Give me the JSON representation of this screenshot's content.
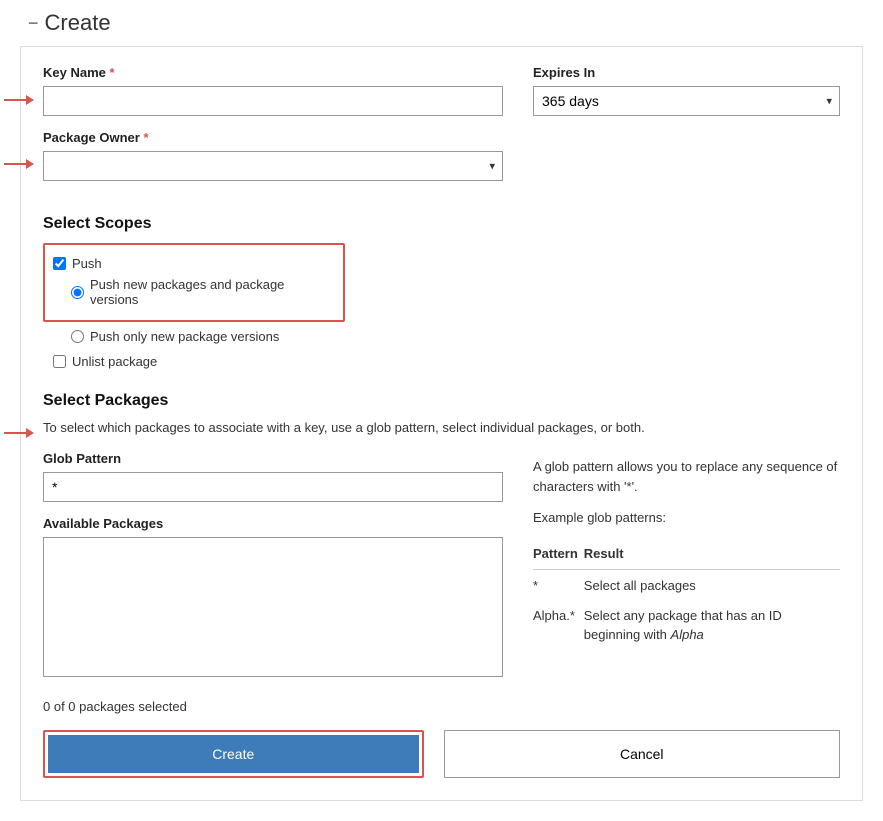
{
  "header": {
    "title": "Create",
    "collapse_symbol": "−"
  },
  "key_name": {
    "label": "Key Name",
    "value": ""
  },
  "expires_in": {
    "label": "Expires In",
    "selected": "365 days"
  },
  "package_owner": {
    "label": "Package Owner",
    "selected": ""
  },
  "scopes": {
    "heading": "Select Scopes",
    "push": {
      "label": "Push",
      "checked": true
    },
    "push_new": {
      "label": "Push new packages and package versions",
      "checked": true
    },
    "push_only_new": {
      "label": "Push only new package versions",
      "checked": false
    },
    "unlist": {
      "label": "Unlist package",
      "checked": false
    }
  },
  "packages": {
    "heading": "Select Packages",
    "help": "To select which packages to associate with a key, use a glob pattern, select individual packages, or both.",
    "glob_label": "Glob Pattern",
    "glob_value": "*",
    "available_label": "Available Packages",
    "selection_text": "0 of 0 packages selected"
  },
  "glob_hint": {
    "intro": "A glob pattern allows you to replace any sequence of characters with '*'.",
    "example_heading": "Example glob patterns:",
    "th_pattern": "Pattern",
    "th_result": "Result",
    "row1_pattern": "*",
    "row1_result": "Select all packages",
    "row2_pattern": "Alpha.*",
    "row2_result_prefix": "Select any package that has an ID beginning with ",
    "row2_result_italic": "Alpha"
  },
  "buttons": {
    "create": "Create",
    "cancel": "Cancel"
  }
}
